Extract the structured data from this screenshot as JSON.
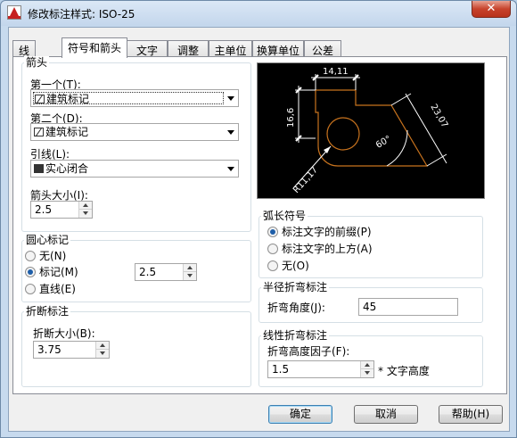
{
  "window": {
    "title": "修改标注样式: ISO-25",
    "close_label": "✕"
  },
  "tabs": [
    {
      "label": "线"
    },
    {
      "label": "符号和箭头"
    },
    {
      "label": "文字"
    },
    {
      "label": "调整"
    },
    {
      "label": "主单位"
    },
    {
      "label": "换算单位"
    },
    {
      "label": "公差"
    }
  ],
  "arrowheads": {
    "title": "箭头",
    "first_label": "第一个(T):",
    "first_value": "建筑标记",
    "second_label": "第二个(D):",
    "second_value": "建筑标记",
    "leader_label": "引线(L):",
    "leader_value": "实心闭合",
    "size_label": "箭头大小(I):",
    "size_value": "2.5"
  },
  "center_marks": {
    "title": "圆心标记",
    "options": [
      "无(N)",
      "标记(M)",
      "直线(E)"
    ],
    "selected": 1,
    "size_value": "2.5"
  },
  "dim_break": {
    "title": "折断标注",
    "size_label": "折断大小(B):",
    "size_value": "3.75"
  },
  "preview": {
    "dim_top": "14,11",
    "dim_left": "16,6",
    "dim_right": "23,07",
    "dim_angle": "60°",
    "dim_radius": "R11,17"
  },
  "arc_length": {
    "title": "弧长符号",
    "options": [
      "标注文字的前缀(P)",
      "标注文字的上方(A)",
      "无(O)"
    ],
    "selected": 0
  },
  "radius_jog": {
    "title": "半径折弯标注",
    "angle_label": "折弯角度(J):",
    "angle_value": "45"
  },
  "linear_jog": {
    "title": "线性折弯标注",
    "factor_label": "折弯高度因子(F):",
    "factor_value": "1.5",
    "suffix": "* 文字高度"
  },
  "buttons": {
    "ok": "确定",
    "cancel": "取消",
    "help": "帮助(H)"
  },
  "colors": {
    "preview_bg": "#000000",
    "preview_lines": "#ffffff",
    "preview_shape": "#c8731e"
  }
}
